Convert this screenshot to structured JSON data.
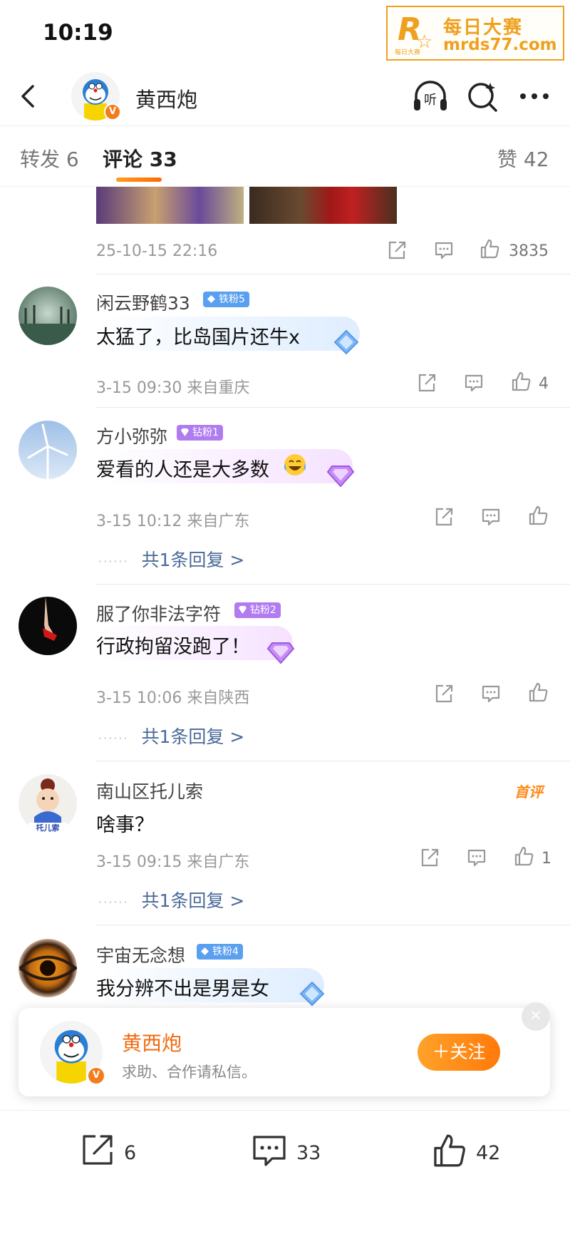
{
  "status_bar": {
    "time": "10:19"
  },
  "watermark": {
    "brand_small": "每日大赛",
    "title": "每日大赛",
    "url": "mrds77.com"
  },
  "nav": {
    "user_name": "黄西炮",
    "listen_label": "听"
  },
  "tabs": {
    "repost": "转发 6",
    "comments": "评论 33",
    "likes": "赞 42"
  },
  "post": {
    "time": "25-10-15 22:16",
    "like_count": "3835"
  },
  "comments": [
    {
      "user": "闲云野鹤33",
      "badge": "铁粉5",
      "badge_type": "iron",
      "text": "太猛了，比岛国片还牛x",
      "time": "3-15 09:30",
      "location": "来自重庆",
      "likes": "4",
      "replies": ""
    },
    {
      "user": "方小弥弥",
      "badge": "钻粉1",
      "badge_type": "diamond",
      "text": "爱看的人还是大多数",
      "emoji": "laugh-cry-emoji",
      "time": "3-15 10:12",
      "location": "来自广东",
      "likes": "",
      "replies": "共1条回复 >"
    },
    {
      "user": "服了你非法字符",
      "badge": "钻粉2",
      "badge_type": "diamond",
      "text": "行政拘留没跑了！",
      "time": "3-15 10:06",
      "location": "来自陕西",
      "likes": "",
      "replies": "共1条回复 >"
    },
    {
      "user": "南山区托儿索",
      "badge": "",
      "badge_type": "",
      "tag": "首评",
      "text": "啥事？",
      "time": "3-15 09:15",
      "location": "来自广东",
      "likes": "1",
      "replies": "共1条回复 >",
      "avatar_text": "托儿索"
    },
    {
      "user": "宇宙无念想",
      "badge": "铁粉4",
      "badge_type": "iron",
      "text": "我分辨不出是男是女",
      "time": "",
      "location": "",
      "likes": "",
      "replies": ""
    }
  ],
  "follow_popup": {
    "name": "黄西炮",
    "description": "求助、合作请私信。",
    "follow_label": "＋关注",
    "close_icon": "×"
  },
  "bottom_bar": {
    "repost_count": "6",
    "comment_count": "33",
    "like_count": "42"
  },
  "colors": {
    "accent": "#ff7a0a",
    "link": "#4a6a98",
    "iron_badge": "#5aa0f0",
    "diamond_badge": "#b07cf0"
  }
}
